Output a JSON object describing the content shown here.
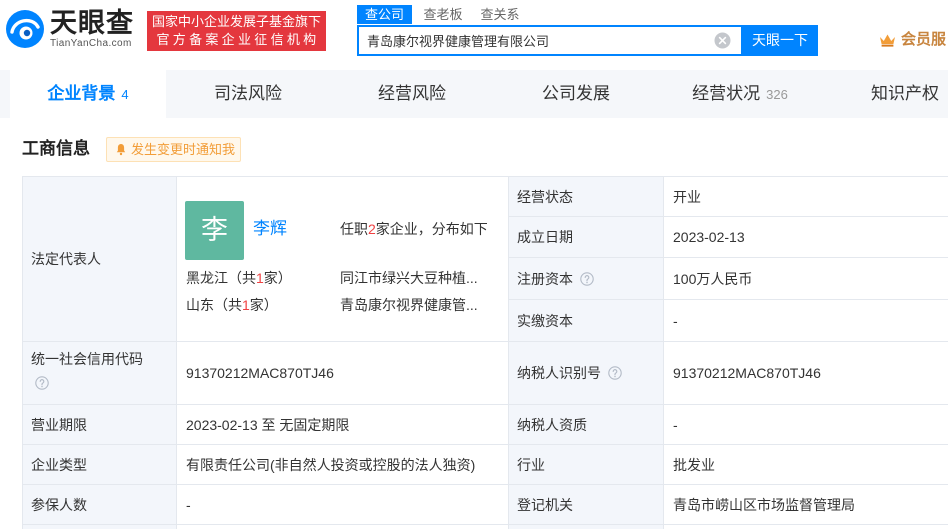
{
  "colors": {
    "accent": "#0084ff",
    "badge": "#e4373e",
    "highlight": "#f04142",
    "avatar": "#5fb8a0",
    "notify": "#f29d38",
    "member": "#c8853f"
  },
  "header": {
    "logo": {
      "icon": "tianyancha-eye-logo",
      "name": "天眼查",
      "domain": "TianYanCha.com"
    },
    "badge": {
      "line1": "国家中小企业发展子基金旗下",
      "line2": "官方备案企业征信机构"
    },
    "search_tabs": [
      {
        "label": "查公司",
        "active": true
      },
      {
        "label": "查老板",
        "active": false
      },
      {
        "label": "查关系",
        "active": false
      }
    ],
    "search": {
      "value": "青岛康尔视界健康管理有限公司",
      "clear_icon": "clear-icon"
    },
    "search_button": "天眼一下",
    "member": {
      "icon": "crown-icon",
      "label": "会员服"
    }
  },
  "nav": {
    "tabs": [
      {
        "label": "企业背景",
        "count": "4",
        "active": true
      },
      {
        "label": "司法风险",
        "active": false
      },
      {
        "label": "经营风险",
        "active": false
      },
      {
        "label": "公司发展",
        "active": false
      },
      {
        "label": "经营状况",
        "count": "326",
        "active": false
      },
      {
        "label": "知识产权",
        "active": false
      }
    ]
  },
  "section": {
    "title": "工商信息",
    "notify": {
      "icon": "bell-icon",
      "label": "发生变更时通知我"
    }
  },
  "legal_rep": {
    "label": "法定代表人",
    "avatar": "李",
    "name": "李辉",
    "summary": {
      "prefix": "任职",
      "count": "2",
      "suffix": "家企业，分布如下"
    },
    "regions": [
      {
        "prefix": "黑龙江（共",
        "count": "1",
        "suffix": "家）",
        "company": "同江市绿兴大豆种植..."
      },
      {
        "prefix": "山东（共",
        "count": "1",
        "suffix": "家）",
        "company": "青岛康尔视界健康管..."
      }
    ]
  },
  "fields": {
    "status": {
      "label": "经营状态",
      "value": "开业"
    },
    "founded": {
      "label": "成立日期",
      "value": "2023-02-13"
    },
    "registered_capital": {
      "label": "注册资本",
      "value": "100万人民币",
      "icon": "help-circle-icon"
    },
    "paid_in_capital": {
      "label": "实缴资本",
      "value": "-"
    },
    "credit_code": {
      "label": "统一社会信用代码",
      "value": "91370212MAC870TJ46",
      "icon": "help-circle-icon"
    },
    "taxpayer_id": {
      "label": "纳税人识别号",
      "value": "91370212MAC870TJ46",
      "icon": "help-circle-icon"
    },
    "business_term": {
      "label": "营业期限",
      "value": "2023-02-13 至 无固定期限"
    },
    "taxpayer_qualification": {
      "label": "纳税人资质",
      "value": "-"
    },
    "company_type": {
      "label": "企业类型",
      "value": "有限责任公司(非自然人投资或控股的法人独资)"
    },
    "industry": {
      "label": "行业",
      "value": "批发业"
    },
    "insured_count": {
      "label": "参保人数",
      "value": "-"
    },
    "registration_authority": {
      "label": "登记机关",
      "value": "青岛市崂山区市场监督管理局"
    }
  }
}
